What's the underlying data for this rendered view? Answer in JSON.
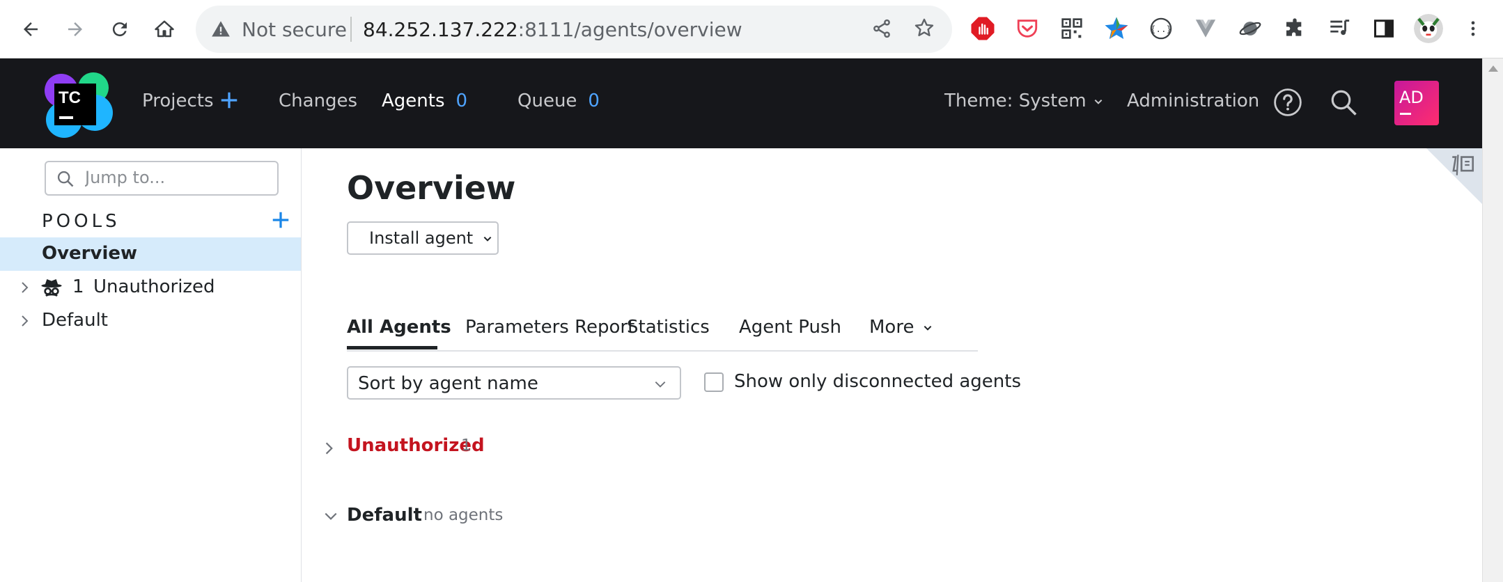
{
  "browser": {
    "security_label": "Not secure",
    "url_host": "84.252.137.222",
    "url_rest": ":8111/agents/overview"
  },
  "header": {
    "logo_text": "TC",
    "nav": {
      "projects": "Projects",
      "changes": "Changes",
      "agents": "Agents",
      "agents_count": "0",
      "queue": "Queue",
      "queue_count": "0"
    },
    "theme": "Theme: System",
    "administration": "Administration",
    "avatar_initials": "AD"
  },
  "sidebar": {
    "search_placeholder": "Jump to...",
    "pools_title": "POOLS",
    "items": [
      {
        "label": "Overview"
      },
      {
        "count": "1",
        "label": "Unauthorized"
      },
      {
        "label": "Default"
      }
    ]
  },
  "main": {
    "title": "Overview",
    "install_button": "Install agent",
    "tabs": [
      {
        "label": "All Agents"
      },
      {
        "label": "Parameters Report"
      },
      {
        "label": "Statistics"
      },
      {
        "label": "Agent Push"
      },
      {
        "label": "More"
      }
    ],
    "sort_select": "Sort by agent name",
    "disconnected_checkbox": "Show only disconnected agents",
    "groups": [
      {
        "name": "Unauthorized",
        "meta": "1"
      },
      {
        "name": "Default",
        "meta": "no agents"
      }
    ]
  },
  "colors": {
    "header_bg": "#16171b",
    "accent_blue": "#4fa4ff",
    "selected_bg": "#d6ebfb",
    "unauthorized_red": "#c4141f",
    "avatar_pink": "#d8178e"
  }
}
